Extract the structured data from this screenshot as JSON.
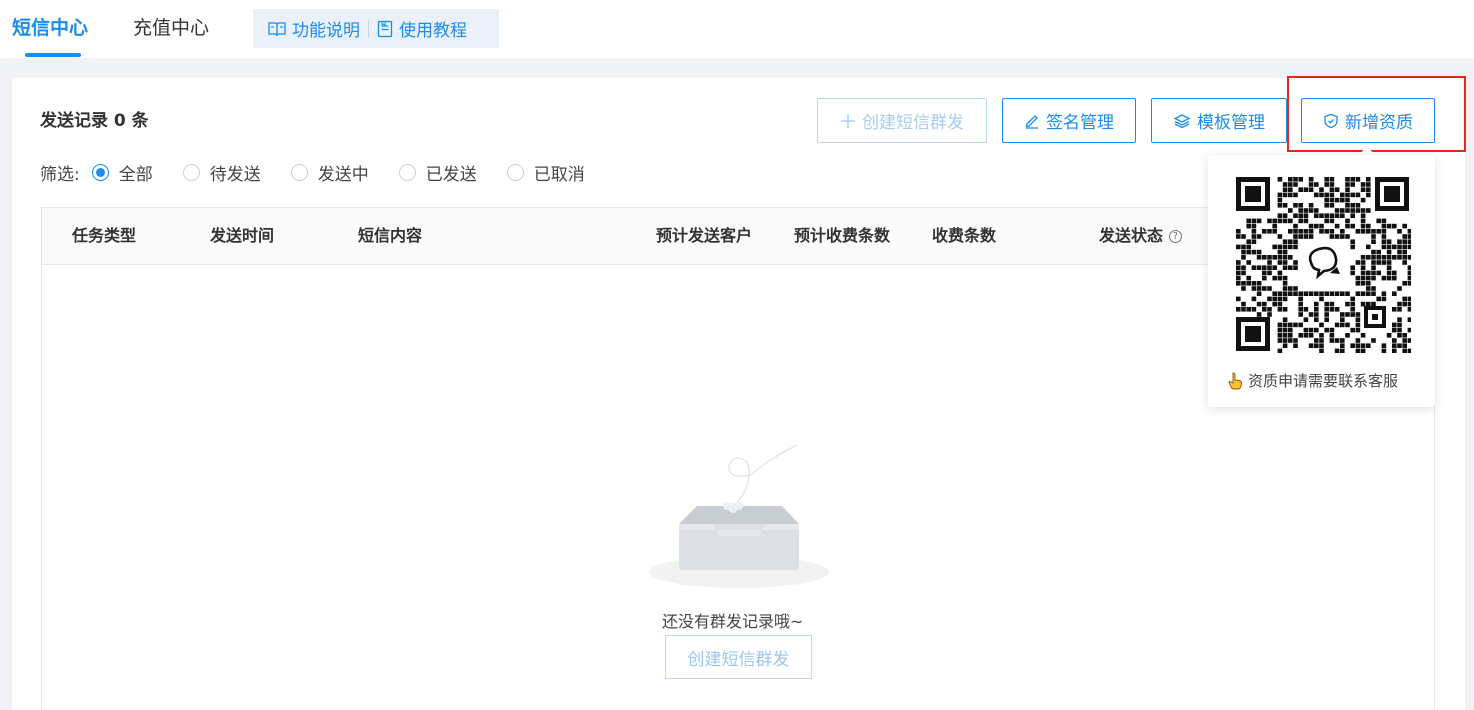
{
  "tabs": {
    "sms_center": "短信中心",
    "recharge_center": "充值中心"
  },
  "help_links": {
    "feature_desc": "功能说明",
    "tutorial": "使用教程"
  },
  "records": {
    "title": "发送记录 0 条"
  },
  "toolbar": {
    "create_group_label": "创建短信群发",
    "sign_manage_label": "签名管理",
    "template_manage_label": "模板管理",
    "add_qualification_label": "新增资质"
  },
  "filter": {
    "label": "筛选:",
    "options": [
      "全部",
      "待发送",
      "发送中",
      "已发送",
      "已取消"
    ],
    "selected": "全部"
  },
  "table": {
    "columns": [
      "任务类型",
      "发送时间",
      "短信内容",
      "预计发送客户",
      "预计收费条数",
      "收费条数",
      "发送状态"
    ]
  },
  "empty": {
    "text": "还没有群发记录哦~",
    "button_label": "创建短信群发"
  },
  "popover": {
    "text": "资质申请需要联系客服"
  },
  "colors": {
    "accent": "#1a8cf0",
    "highlight": "#e8281f"
  }
}
